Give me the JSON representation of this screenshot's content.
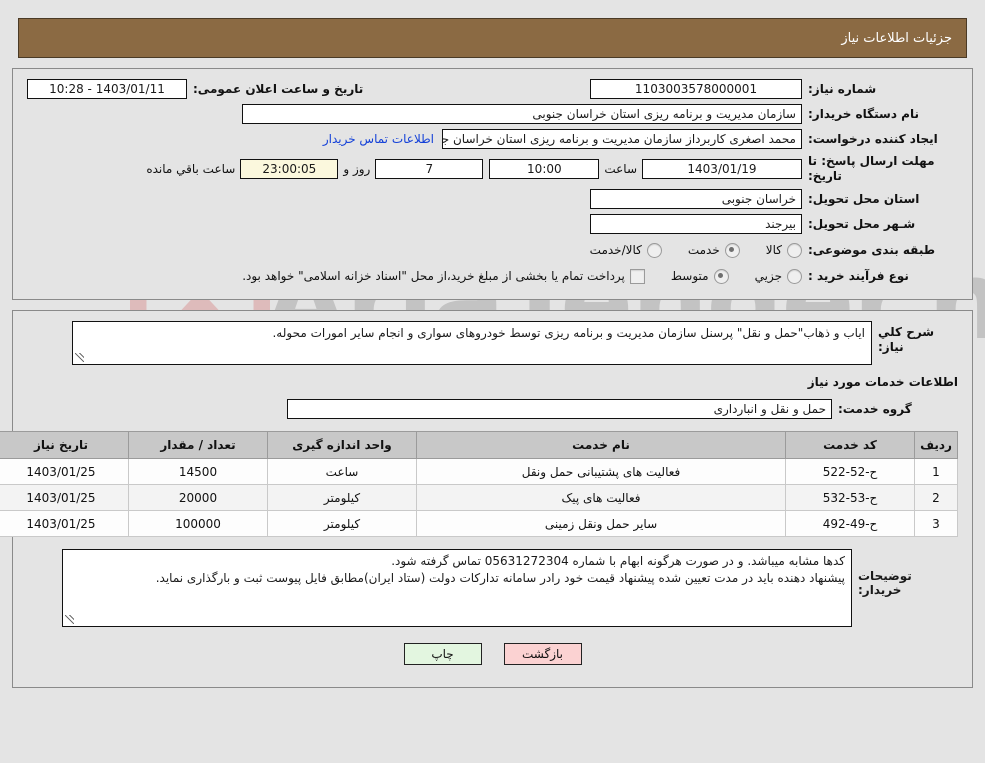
{
  "header": {
    "title": "جزئیات اطلاعات نیاز",
    "bar_color": "#8b6a43"
  },
  "watermark": {
    "text": "AriaTender.net"
  },
  "top_form": {
    "need_number_label": "شماره نیاز:",
    "need_number_value": "1103003578000001",
    "announce_label": "تاریخ و ساعت اعلان عمومی:",
    "announce_value": "1403/01/11 - 10:28",
    "buyer_org_label": "نام دستگاه خریدار:",
    "buyer_org_value": "سازمان مدیریت و برنامه ریزی استان خراسان جنوبی",
    "creator_label": "ایجاد کننده درخواست:",
    "creator_value": "محمد  اصغری کاربرداز سازمان مدیریت و برنامه ریزی استان خراسان جنوبی",
    "contact_link": "اطلاعات تماس خریدار",
    "deadline_label": "مهلت ارسال پاسخ: تا تاریخ:",
    "deadline_date": "1403/01/19",
    "hour_label": "ساعت",
    "deadline_time": "10:00",
    "remaining_days": "7",
    "days_and_label": "روز و",
    "remaining_clock": "23:00:05",
    "remaining_suffix": "ساعت باقي مانده",
    "province_label": "استان محل تحویل:",
    "province_value": "خراسان جنوبی",
    "city_label": "شـهر محل تحویل:",
    "city_value": "بیرجند",
    "category_label": "طبقه بندی موضوعی:",
    "category_options": [
      {
        "label": "کالا",
        "selected": false
      },
      {
        "label": "خدمت",
        "selected": true
      },
      {
        "label": "کالا/خدمت",
        "selected": false
      }
    ],
    "process_label": "نوع فرآیند خرید :",
    "process_options": [
      {
        "label": "جزیي",
        "selected": false
      },
      {
        "label": "متوسط",
        "selected": true
      }
    ],
    "treasury_checkbox_label": "پرداخت تمام یا بخشی از مبلغ خرید،از محل \"اسناد خزانه اسلامی\" خواهد بود.",
    "treasury_checked": false
  },
  "main": {
    "need_desc_label": "شرح کلي نياز:",
    "need_desc_value": "ایاب و ذهاب\"حمل و نقل\" پرسنل سازمان مدیریت و برنامه ریزی توسط خودروهای سواری و انجام سایر امورات محوله.",
    "services_section_title": "اطلاعات خدمات مورد نیاز",
    "service_group_label": "گروه خدمت:",
    "service_group_value": "حمل و نقل و انبارداری",
    "table": {
      "columns": [
        "ردیف",
        "کد خدمت",
        "نام خدمت",
        "واحد اندازه گیری",
        "تعداد / مقدار",
        "تاریخ نیاز"
      ],
      "rows": [
        {
          "row": "1",
          "code": "ح-52-522",
          "name": "فعالیت های پشتیبانی حمل ونقل",
          "unit": "ساعت",
          "qty": "14500",
          "date": "1403/01/25"
        },
        {
          "row": "2",
          "code": "ح-53-532",
          "name": "فعالیت های پیک",
          "unit": "کیلومتر",
          "qty": "20000",
          "date": "1403/01/25"
        },
        {
          "row": "3",
          "code": "ح-49-492",
          "name": "سایر حمل ونقل زمینی",
          "unit": "کیلومتر",
          "qty": "100000",
          "date": "1403/01/25"
        }
      ]
    },
    "notes_label": "توضیحات خریدار:",
    "notes_value": "کدها مشابه میباشد. و در صورت هرگونه ابهام با شماره 05631272304 تماس گرفته شود.\nپیشنهاد دهنده باید در مدت تعیین شده پیشنهاد قیمت خود رادر سامانه تدارکات دولت (ستاد ایران)مطابق فایل پیوست ثبت و بارگذاری نماید."
  },
  "buttons": {
    "back": "بازگشت",
    "print": "چاپ"
  }
}
